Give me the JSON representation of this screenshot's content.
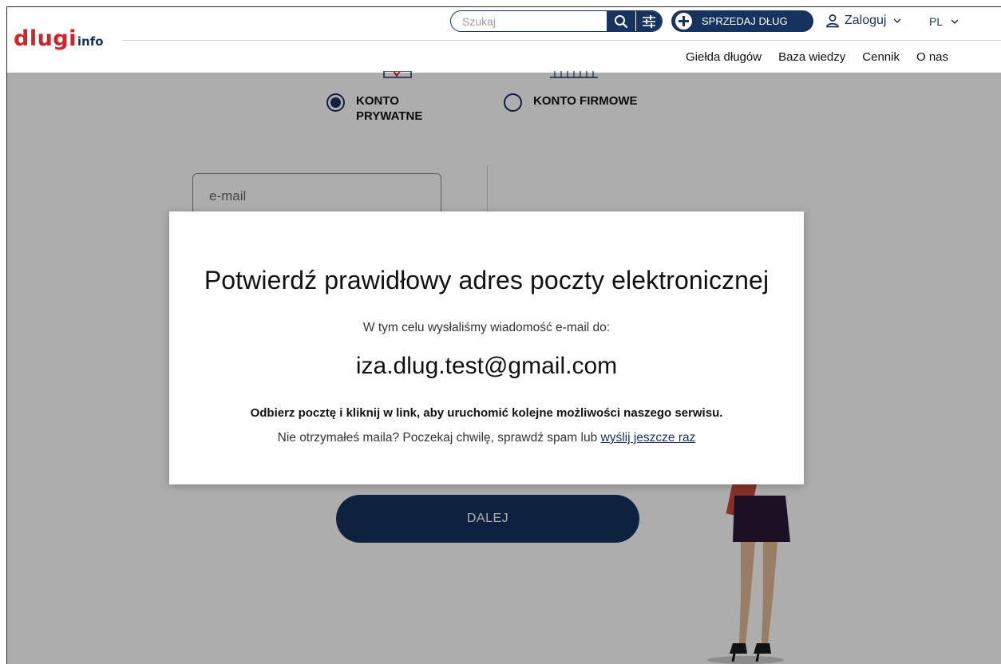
{
  "header": {
    "logo_main": "dlugi",
    "logo_suffix": "info",
    "search_placeholder": "Szukaj",
    "sell_label": "SPRZEDAJ DŁUG",
    "login_label": "Zaloguj",
    "language": "PL",
    "nav": [
      "Giełda długów",
      "Baza wiedzy",
      "Cennik",
      "O nas"
    ]
  },
  "form": {
    "account_types": [
      {
        "label": "KONTO PRYWATNE",
        "selected": true
      },
      {
        "label": "KONTO FIRMOWE",
        "selected": false
      }
    ],
    "email_placeholder": "e-mail",
    "submit_label": "DALEJ"
  },
  "modal": {
    "title": "Potwierdź prawidłowy adres poczty elektronicznej",
    "subtitle": "W tym celu wysłaliśmy wiadomość e-mail do:",
    "email": "iza.dlug.test@gmail.com",
    "instruction_part1": "Odbierz pocztę i ",
    "instruction_bold": "kliknij w link",
    "instruction_part2": ", aby uruchomić kolejne możliwości naszego serwisu.",
    "note_text": "Nie otrzymałeś maila? Poczekaj chwilę, sprawdź spam lub ",
    "resend_link": "wyślij jeszcze raz"
  },
  "colors": {
    "brand_red": "#d2232a",
    "brand_navy": "#16335f",
    "overlay": "rgba(0,0,0,0.32)"
  }
}
